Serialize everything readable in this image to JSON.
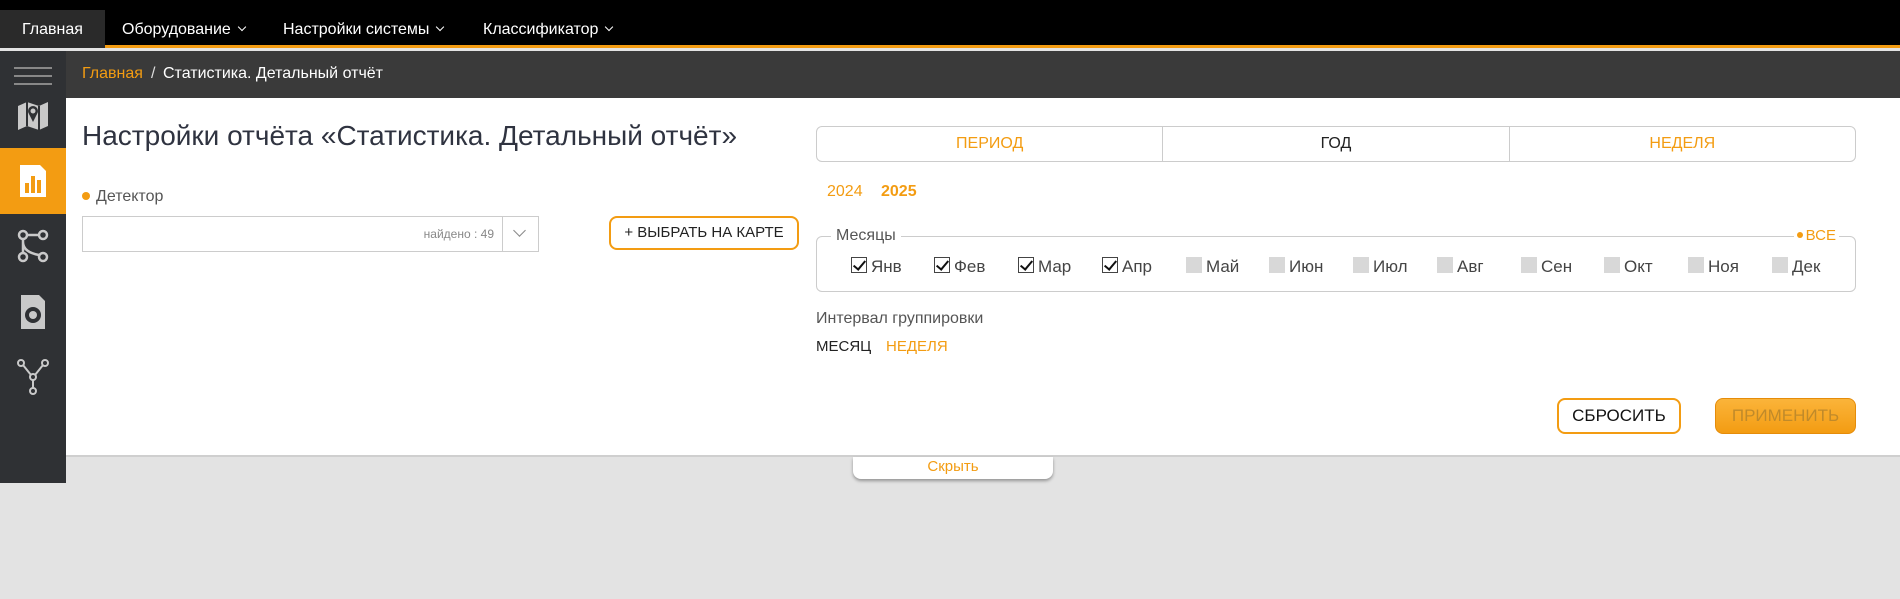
{
  "topnav": {
    "items": [
      {
        "label": "Главная",
        "dropdown": false,
        "active": true
      },
      {
        "label": "Оборудование",
        "dropdown": true
      },
      {
        "label": "Настройки системы",
        "dropdown": true
      },
      {
        "label": "Классификатор",
        "dropdown": true
      }
    ]
  },
  "sidebar": {
    "icons": [
      "map-icon",
      "bar-chart-icon",
      "network-icon",
      "speaker-icon",
      "fork-icon"
    ],
    "active_index": 1
  },
  "breadcrumb": {
    "home": "Главная",
    "separator": "/",
    "current": "Статистика. Детальный отчёт"
  },
  "main": {
    "title": "Настройки отчёта «Статистика. Детальный отчёт»",
    "detector_label": "Детектор",
    "detector_found": "найдено : 49",
    "map_button": "+ ВЫБРАТЬ НА КАРТЕ",
    "period_tabs": [
      {
        "label": "ПЕРИОД",
        "selected": false
      },
      {
        "label": "ГОД",
        "selected": true
      },
      {
        "label": "НЕДЕЛЯ",
        "selected": false
      }
    ],
    "years": [
      {
        "label": "2024",
        "selected": false
      },
      {
        "label": "2025",
        "selected": true
      }
    ],
    "months_legend": "Месяцы",
    "months_all": "ВСЕ",
    "months": [
      {
        "label": "Янв",
        "checked": true
      },
      {
        "label": "Фев",
        "checked": true
      },
      {
        "label": "Мар",
        "checked": true
      },
      {
        "label": "Апр",
        "checked": true
      },
      {
        "label": "Май",
        "checked": false
      },
      {
        "label": "Июн",
        "checked": false
      },
      {
        "label": "Июл",
        "checked": false
      },
      {
        "label": "Авг",
        "checked": false
      },
      {
        "label": "Сен",
        "checked": false
      },
      {
        "label": "Окт",
        "checked": false
      },
      {
        "label": "Ноя",
        "checked": false
      },
      {
        "label": "Дек",
        "checked": false
      }
    ],
    "interval_label": "Интервал группировки",
    "interval_options": [
      {
        "label": "МЕСЯЦ",
        "selected": true
      },
      {
        "label": "НЕДЕЛЯ",
        "selected": false
      }
    ],
    "reset_button": "СБРОСИТЬ",
    "apply_button": "ПРИМЕНИТЬ",
    "hide_label": "Скрыть"
  },
  "colors": {
    "accent": "#f39c12",
    "topbar": "#000000",
    "sidebar": "#2f3134",
    "breadcrumb_bar": "#3a3a3a"
  }
}
